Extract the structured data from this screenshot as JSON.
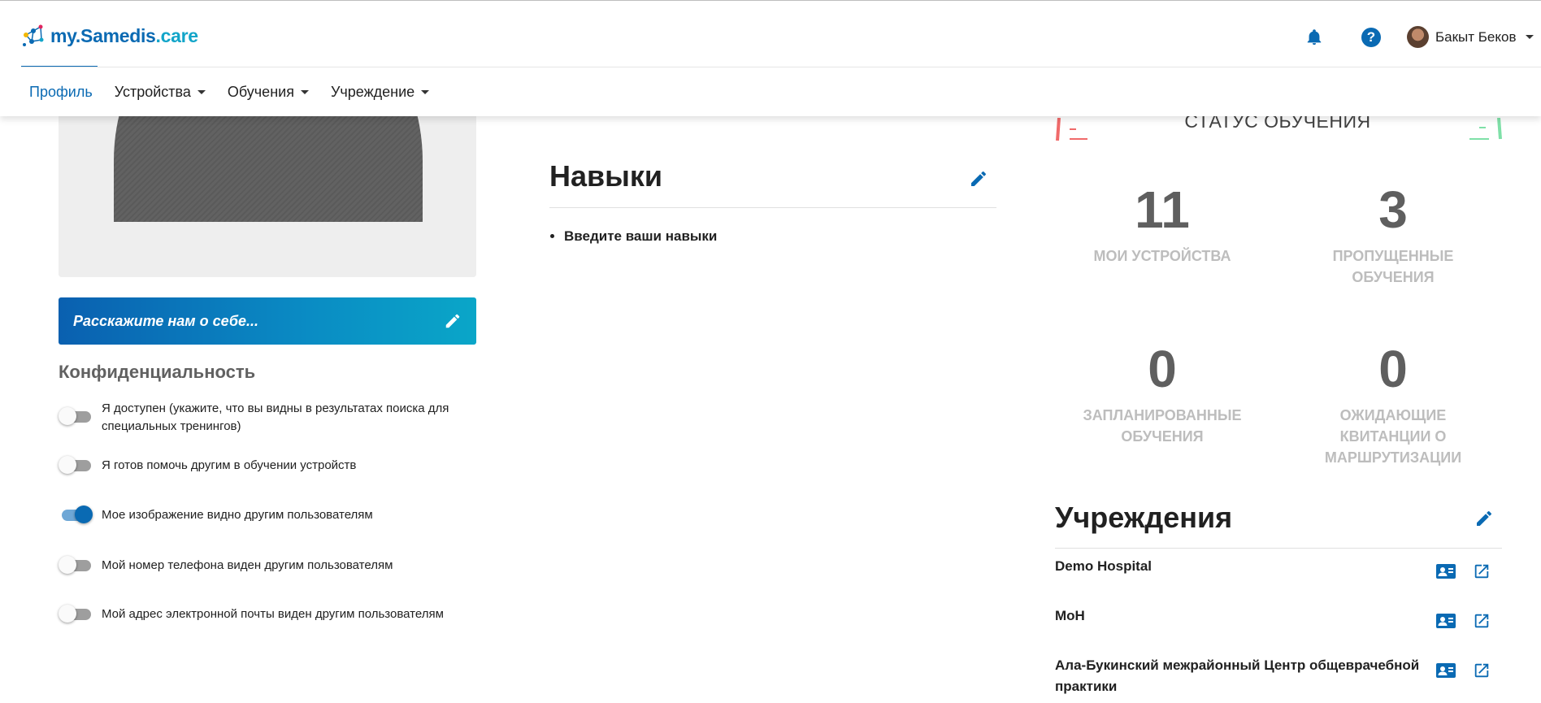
{
  "app": {
    "logo_prefix": "my.",
    "logo_main": "Samedis",
    "logo_suffix": ".care"
  },
  "header": {
    "user_name": "Бакыт Беков",
    "help_glyph": "?",
    "icons": [
      "bell-icon",
      "help-icon",
      "avatar"
    ]
  },
  "nav": {
    "items": [
      {
        "label": "Профиль",
        "active": true
      },
      {
        "label": "Устройства",
        "dropdown": true
      },
      {
        "label": "Обучения",
        "dropdown": true
      },
      {
        "label": "Учреждение",
        "dropdown": true
      }
    ]
  },
  "profile": {
    "about_placeholder": "Расскажите нам о себе..."
  },
  "privacy": {
    "title": "Конфиденциальность",
    "toggles": [
      {
        "label": "Я доступен (укажите, что вы видны в результатах поиска для специальных тренингов)",
        "on": false
      },
      {
        "label": "Я готов помочь другим в обучении устройств",
        "on": false
      },
      {
        "label": "Мое изображение видно другим пользователям",
        "on": true
      },
      {
        "label": "Мой номер телефона виден другим пользователям",
        "on": false
      },
      {
        "label": "Мой адрес электронной почты виден другим пользователям",
        "on": false
      }
    ]
  },
  "skills": {
    "title": "Навыки",
    "items": [
      "Введите ваши навыки"
    ]
  },
  "training_status": {
    "title": "СТАТУС ОБУЧЕНИЯ",
    "stats": [
      {
        "value": "11",
        "label": "МОИ УСТРОЙСТВА"
      },
      {
        "value": "3",
        "label": "ПРОПУЩЕННЫЕ ОБУЧЕНИЯ"
      },
      {
        "value": "0",
        "label": "ЗАПЛАНИРОВАННЫЕ ОБУЧЕНИЯ"
      },
      {
        "value": "0",
        "label": "ОЖИДАЮЩИЕ КВИТАНЦИИ О МАРШРУТИЗАЦИИ"
      }
    ]
  },
  "institutions": {
    "title": "Учреждения",
    "items": [
      {
        "name": "Demo Hospital"
      },
      {
        "name": "MoH"
      },
      {
        "name": "Ала-Букинский межрайонный Центр общеврачебной практики"
      }
    ]
  },
  "colors": {
    "primary": "#0a6ab3",
    "accent": "#12a5c9",
    "stat_number": "#5f5f5f",
    "stat_label": "#bdbdbd",
    "decor_red": "#f06a6a",
    "decor_green": "#7fe0a8"
  }
}
